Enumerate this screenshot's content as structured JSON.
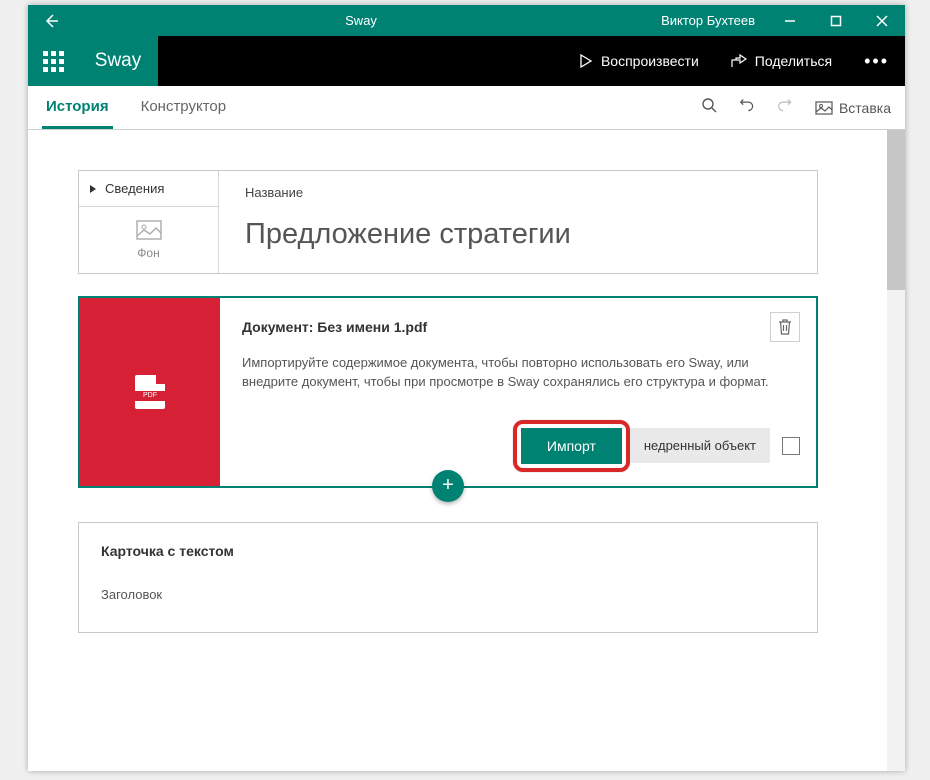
{
  "titlebar": {
    "app_title": "Sway",
    "username": "Виктор Бухтеев"
  },
  "app_tabs": {
    "app_name": "Sway",
    "play_label": "Воспроизвести",
    "share_label": "Поделиться"
  },
  "toolbar": {
    "tab_story": "История",
    "tab_design": "Конструктор",
    "insert_label": "Вставка"
  },
  "title_card": {
    "details_label": "Сведения",
    "background_label": "Фон",
    "field_label": "Название",
    "title_value": "Предложение стратегии"
  },
  "doc_card": {
    "pdf_badge": "PDF",
    "title": "Документ: Без имени 1.pdf",
    "description": "Импортируйте содержимое документа, чтобы повторно использовать его Sway, или внедрите документ, чтобы при просмотре в Sway сохранялись его структура и формат.",
    "import_label": "Импорт",
    "embed_label": "недренный объект"
  },
  "text_card": {
    "header": "Карточка с текстом",
    "placeholder": "Заголовок"
  },
  "colors": {
    "brand": "#008272",
    "pdf_red": "#d62035",
    "highlight": "#d82828"
  }
}
